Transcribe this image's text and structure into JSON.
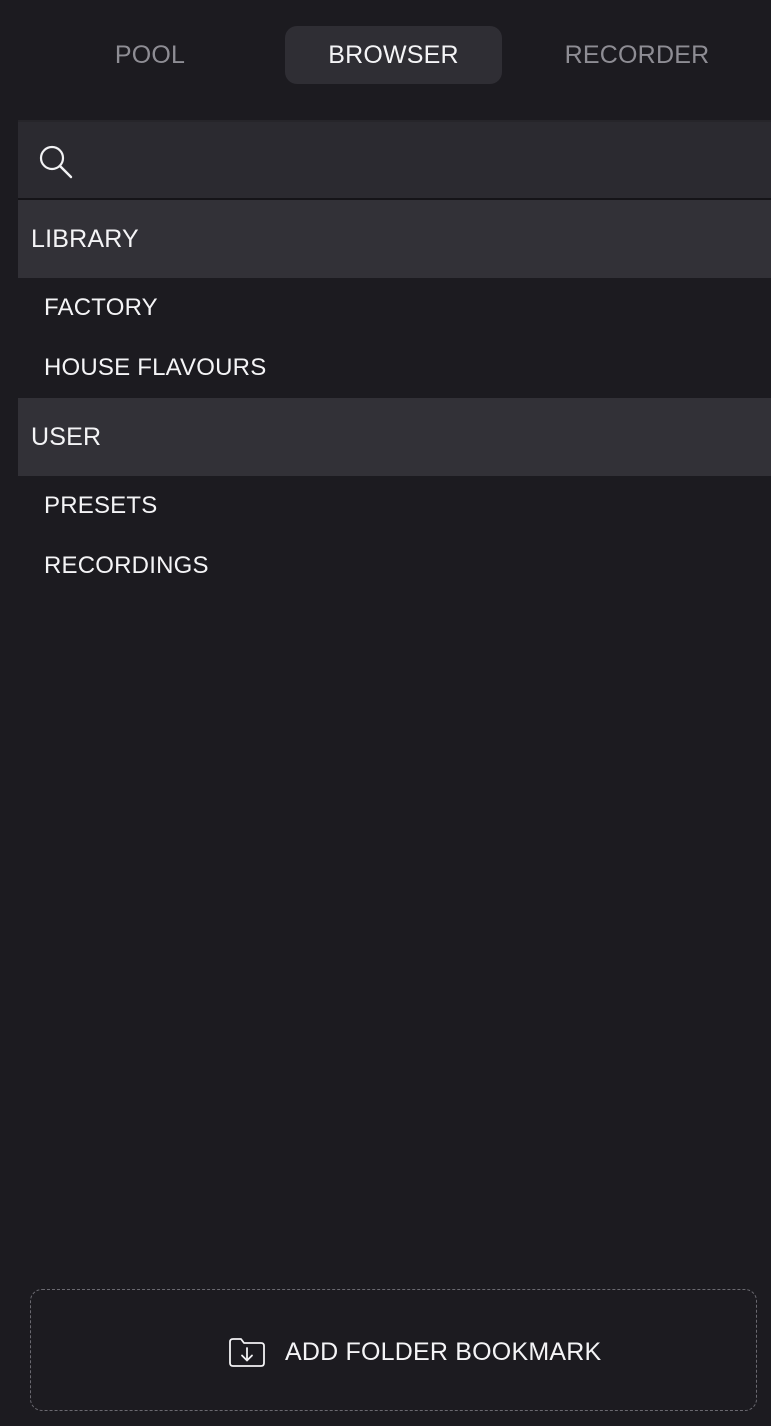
{
  "tabs": [
    {
      "label": "POOL",
      "active": false
    },
    {
      "label": "BROWSER",
      "active": true
    },
    {
      "label": "RECORDER",
      "active": false
    }
  ],
  "search": {
    "value": "",
    "placeholder": "",
    "icon": "search-icon"
  },
  "sections": [
    {
      "title": "LIBRARY",
      "items": [
        "FACTORY",
        "HOUSE FLAVOURS"
      ]
    },
    {
      "title": "USER",
      "items": [
        "PRESETS",
        "RECORDINGS"
      ]
    }
  ],
  "add_bookmark": {
    "label": "ADD FOLDER BOOKMARK",
    "icon": "folder-download-icon"
  },
  "colors": {
    "background": "#1c1b20",
    "active_tab": "#2f2e34",
    "section_header": "#323137",
    "text": "#f4f4f6",
    "muted_text": "#8e8d94"
  }
}
